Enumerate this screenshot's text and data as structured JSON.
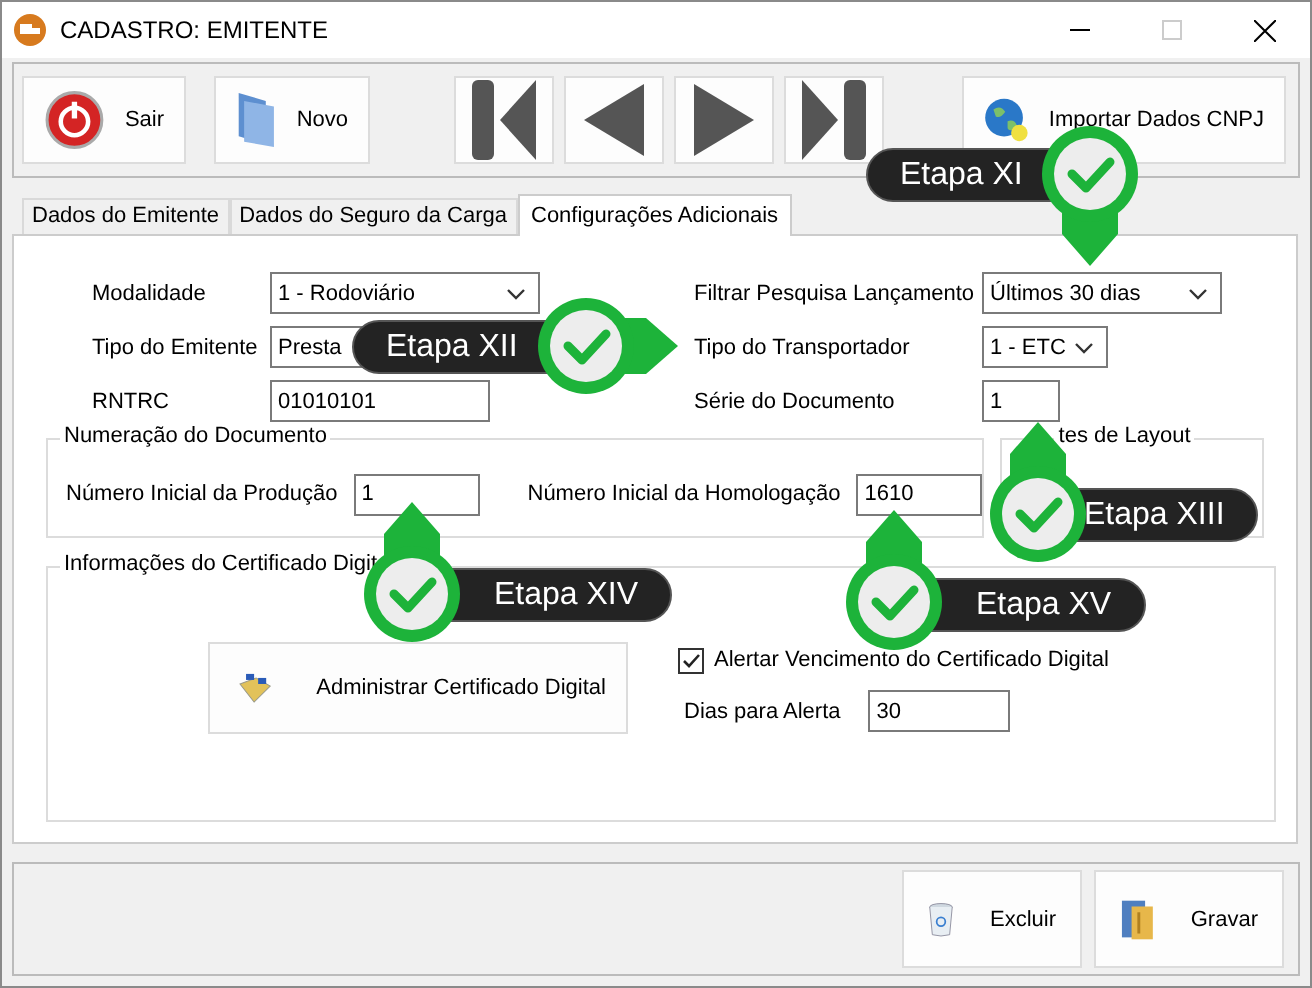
{
  "window": {
    "title": "CADASTRO: EMITENTE"
  },
  "toolbar": [
    {
      "kind": "exit",
      "label": "Sair"
    },
    {
      "kind": "new",
      "label": "Novo"
    },
    {
      "kind": "first"
    },
    {
      "kind": "prev"
    },
    {
      "kind": "next"
    },
    {
      "kind": "last"
    },
    {
      "kind": "import",
      "label": "Importar Dados CNPJ"
    }
  ],
  "tabs": [
    {
      "label": "Dados do Emitente",
      "selected": false
    },
    {
      "label": "Dados do Seguro da Carga",
      "selected": false
    },
    {
      "label": "Configurações Adicionais",
      "selected": true
    }
  ],
  "fields_left": [
    {
      "label": "Modalidade",
      "kind": "combo",
      "value": "1 - Rodoviário"
    },
    {
      "label": "Tipo do Emitente",
      "kind": "combo",
      "value": "Presta"
    },
    {
      "label": "RNTRC",
      "kind": "text",
      "value": "01010101"
    }
  ],
  "fields_right": [
    {
      "label": "Filtrar Pesquisa Lançamento",
      "kind": "combo",
      "value": "Últimos 30 dias"
    },
    {
      "label": "Tipo do Transportador",
      "kind": "combo",
      "value": "1 - ETC"
    },
    {
      "label": "Série do Documento",
      "kind": "text",
      "value": "1"
    }
  ],
  "numbering": {
    "title": "Numeração do Documento",
    "fields": [
      {
        "label": "Número Inicial da Produção",
        "value": "1"
      },
      {
        "label": "Número Inicial da Homologação",
        "value": "1610"
      }
    ]
  },
  "layout_group": {
    "title": "tes de Layout"
  },
  "certificate": {
    "title": "Informações do Certificado Digit",
    "button": "Administrar Certificado Digital",
    "alert": {
      "label": "Alertar Vencimento do Certificado Digital",
      "checked": true
    },
    "days": {
      "label": "Dias para Alerta",
      "value": "30"
    }
  },
  "footer_buttons": [
    {
      "kind": "delete",
      "label": "Excluir"
    },
    {
      "kind": "save",
      "label": "Gravar"
    }
  ],
  "callouts": [
    {
      "label": "Etapa XI",
      "kind": "down"
    },
    {
      "label": "Etapa XII",
      "kind": "right"
    },
    {
      "label": "Etapa XIII",
      "kind": "up"
    },
    {
      "label": "Etapa XIV",
      "kind": "up"
    },
    {
      "label": "Etapa XV",
      "kind": "up"
    }
  ]
}
